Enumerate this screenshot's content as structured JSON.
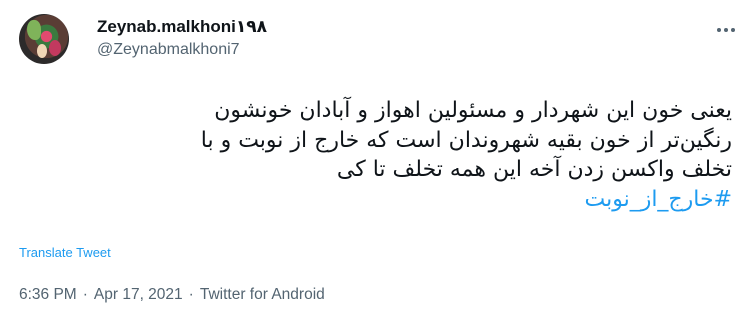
{
  "author": {
    "display_name": "Zeynab.malkhoni۱۹۸",
    "handle": "@Zeynabmalkhoni7"
  },
  "tweet": {
    "lines": [
      "یعنی خون این شهردار و مسئولین اهواز و آبادان خونشون",
      "رنگین‌تر از خون بقیه شهروندان است که خارج از نوبت و با",
      "تخلف واکسن زدن آخه این همه تخلف تا کی"
    ],
    "hashtag": "#خارج_از_نوبت"
  },
  "actions": {
    "translate_label": "Translate Tweet"
  },
  "meta": {
    "time": "6:36 PM",
    "separator": "·",
    "date": "Apr 17, 2021",
    "source": "Twitter for Android"
  },
  "icons": {
    "more": "more-horizontal-icon"
  },
  "colors": {
    "link": "#1d9bf0",
    "text": "#0f1419",
    "secondary": "#536471"
  }
}
